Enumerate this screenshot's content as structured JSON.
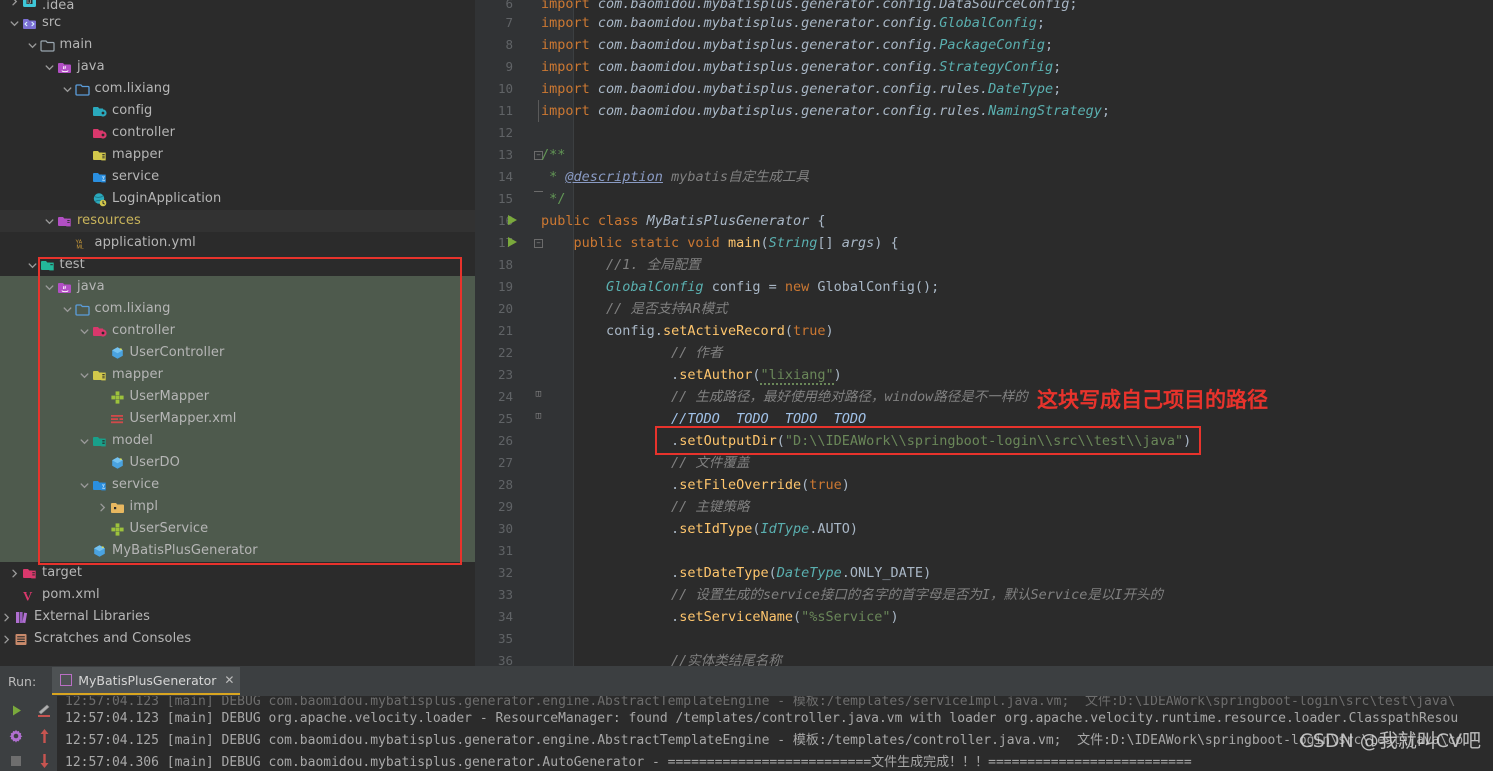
{
  "project_tree": {
    "rows": [
      {
        "indent": 0,
        "arrow": "right",
        "icon": "idea-folder-icon",
        "label": ".idea",
        "state": "normal",
        "clipped": true
      },
      {
        "indent": 0,
        "arrow": "down",
        "icon": "src-folder-icon",
        "label": "src",
        "state": "normal"
      },
      {
        "indent": 1,
        "arrow": "down",
        "icon": "plain-folder-icon",
        "label": "main",
        "state": "normal"
      },
      {
        "indent": 2,
        "arrow": "down",
        "icon": "java-source-folder-icon",
        "label": "java",
        "state": "normal"
      },
      {
        "indent": 3,
        "arrow": "down",
        "icon": "package-folder-icon",
        "label": "com.lixiang",
        "state": "normal"
      },
      {
        "indent": 4,
        "arrow": "none",
        "icon": "config-package-icon",
        "label": "config",
        "state": "normal"
      },
      {
        "indent": 4,
        "arrow": "none",
        "icon": "controller-package-icon",
        "label": "controller",
        "state": "normal"
      },
      {
        "indent": 4,
        "arrow": "none",
        "icon": "mapper-package-icon",
        "label": "mapper",
        "state": "normal"
      },
      {
        "indent": 4,
        "arrow": "none",
        "icon": "service-package-icon",
        "label": "service",
        "state": "normal"
      },
      {
        "indent": 4,
        "arrow": "none",
        "icon": "spring-boot-app-icon",
        "label": "LoginApplication",
        "state": "normal"
      },
      {
        "indent": 2,
        "arrow": "down",
        "icon": "resources-folder-icon",
        "label": "resources",
        "state": "dim",
        "color": "yellow"
      },
      {
        "indent": 3,
        "arrow": "none",
        "icon": "yaml-file-icon",
        "label": "application.yml",
        "state": "normal"
      },
      {
        "indent": 1,
        "arrow": "down",
        "icon": "test-folder-icon",
        "label": "test",
        "state": "normal"
      },
      {
        "indent": 2,
        "arrow": "down",
        "icon": "java-source-folder-icon",
        "label": "java",
        "state": "selected"
      },
      {
        "indent": 3,
        "arrow": "down",
        "icon": "package-folder-icon",
        "label": "com.lixiang",
        "state": "selected"
      },
      {
        "indent": 4,
        "arrow": "down",
        "icon": "controller-package-icon",
        "label": "controller",
        "state": "selected"
      },
      {
        "indent": 5,
        "arrow": "none",
        "icon": "java-class-icon",
        "label": "UserController",
        "state": "selected"
      },
      {
        "indent": 4,
        "arrow": "down",
        "icon": "mapper-package-icon",
        "label": "mapper",
        "state": "selected"
      },
      {
        "indent": 5,
        "arrow": "none",
        "icon": "java-interface-icon",
        "label": "UserMapper",
        "state": "selected"
      },
      {
        "indent": 5,
        "arrow": "none",
        "icon": "mybatis-xml-icon",
        "label": "UserMapper.xml",
        "state": "selected"
      },
      {
        "indent": 4,
        "arrow": "down",
        "icon": "model-package-icon",
        "label": "model",
        "state": "selected"
      },
      {
        "indent": 5,
        "arrow": "none",
        "icon": "java-class-icon",
        "label": "UserDO",
        "state": "selected"
      },
      {
        "indent": 4,
        "arrow": "down",
        "icon": "service-package-icon",
        "label": "service",
        "state": "selected"
      },
      {
        "indent": 5,
        "arrow": "right",
        "icon": "impl-folder-icon",
        "label": "impl",
        "state": "selected"
      },
      {
        "indent": 5,
        "arrow": "none",
        "icon": "java-interface-icon",
        "label": "UserService",
        "state": "selected"
      },
      {
        "indent": 4,
        "arrow": "none",
        "icon": "java-class-icon",
        "label": "MyBatisPlusGenerator",
        "state": "selected"
      },
      {
        "indent": 0,
        "arrow": "right",
        "icon": "target-folder-icon",
        "label": "target",
        "state": "normal"
      },
      {
        "indent": 0,
        "arrow": "none",
        "icon": "maven-pom-icon",
        "label": "pom.xml",
        "state": "normal"
      },
      {
        "indent": -1,
        "arrow": "right",
        "icon": "external-libraries-icon",
        "label": "External Libraries",
        "state": "normal"
      },
      {
        "indent": -1,
        "arrow": "right",
        "icon": "scratches-icon",
        "label": "Scratches and Consoles",
        "state": "normal"
      }
    ],
    "highlight_box_color": "#e8332c"
  },
  "editor": {
    "annotation": "这块写成自己项目的路径",
    "annotation_color": "#e8332c",
    "highlight_box_color": "#e8332c",
    "lines": [
      {
        "n": "6",
        "clipped": true,
        "html": "<span class=\"imp\">import</span> <span class=\"clsi\">com.baomidou.mybatisplus.generator.config.DataSourceConfig</span><span class=\"pln\">;</span>"
      },
      {
        "n": "7",
        "html": "<span class=\"imp\">import</span> <span class=\"clsi\">com.baomidou.mybatisplus.generator.config.</span><span class=\"type\">GlobalConfig</span><span class=\"pln\">;</span>"
      },
      {
        "n": "8",
        "html": "<span class=\"imp\">import</span> <span class=\"clsi\">com.baomidou.mybatisplus.generator.config.</span><span class=\"type\">PackageConfig</span><span class=\"pln\">;</span>"
      },
      {
        "n": "9",
        "html": "<span class=\"imp\">import</span> <span class=\"clsi\">com.baomidou.mybatisplus.generator.config.</span><span class=\"type\">StrategyConfig</span><span class=\"pln\">;</span>"
      },
      {
        "n": "10",
        "html": "<span class=\"imp\">import</span> <span class=\"clsi\">com.baomidou.mybatisplus.generator.config.rules.</span><span class=\"type\">DateType</span><span class=\"pln\">;</span>"
      },
      {
        "n": "11",
        "foldline": true,
        "html": "<span class=\"imp\">import</span> <span class=\"clsi\">com.baomidou.mybatisplus.generator.config.rules.</span><span class=\"type\">NamingStrategy</span><span class=\"pln\">;</span>"
      },
      {
        "n": "12",
        "html": ""
      },
      {
        "n": "13",
        "fold": "-",
        "html": "<span class=\"doc\">/**</span>"
      },
      {
        "n": "14",
        "html": " <span class=\"doc\">* </span><span class=\"tagl\">@description</span><span class=\"cmt\"> mybatis自定生成工具</span>"
      },
      {
        "n": "15",
        "fold": "u",
        "html": " <span class=\"doc\">*/</span>"
      },
      {
        "n": "16",
        "run": true,
        "html": "<span class=\"kw\">public class </span><span class=\"clsi\">MyBatisPlusGenerator</span> <span class=\"pln\">{</span>"
      },
      {
        "n": "17",
        "run": true,
        "fold": "-",
        "html": "    <span class=\"kw\">public static void </span><span class=\"mth\">main</span><span class=\"pln\">(</span><span class=\"type\">String</span><span class=\"pln\">[] </span><span class=\"clsi\">args</span><span class=\"pln\">) {</span>"
      },
      {
        "n": "18",
        "html": "        <span class=\"cmt\">//1. 全局配置</span>"
      },
      {
        "n": "19",
        "html": "        <span class=\"type\">GlobalConfig</span> <span class=\"pln\">config = </span><span class=\"kw\">new </span><span class=\"pln\">GlobalConfig();</span>"
      },
      {
        "n": "20",
        "html": "        <span class=\"cmt\">// 是否支持AR模式</span>"
      },
      {
        "n": "21",
        "html": "        <span class=\"pln\">config.</span><span class=\"mth\">setActiveRecord</span><span class=\"pln\">(</span><span class=\"kw\">true</span><span class=\"pln\">)</span>"
      },
      {
        "n": "22",
        "html": "                <span class=\"cmt\">// 作者</span>"
      },
      {
        "n": "23",
        "html": "                <span class=\"pln\">.</span><span class=\"mth\">setAuthor</span><span class=\"pln\">(</span><span class=\"str\"><span class=\"squig\">\"lixiang\"</span></span><span class=\"pln\">)</span>"
      },
      {
        "n": "24",
        "fold": "h",
        "html": "                <span class=\"cmt\">// 生成路径，最好使用绝对路径，window路径是不一样的</span>"
      },
      {
        "n": "25",
        "fold": "h2",
        "html": "                <span class=\"todo\">//TODO  TODO  TODO  TODO</span>"
      },
      {
        "n": "26",
        "html": "                <span class=\"pln\">.</span><span class=\"mth\">setOutputDir</span><span class=\"pln\">(</span><span class=\"str\">\"D:\\\\IDEAWork\\\\springboot-login\\\\src\\\\test\\\\java\"</span><span class=\"pln\">)</span>"
      },
      {
        "n": "27",
        "html": "                <span class=\"cmt\">// 文件覆盖</span>"
      },
      {
        "n": "28",
        "html": "                <span class=\"pln\">.</span><span class=\"mth\">setFileOverride</span><span class=\"pln\">(</span><span class=\"kw\">true</span><span class=\"pln\">)</span>"
      },
      {
        "n": "29",
        "html": "                <span class=\"cmt\">// 主键策略</span>"
      },
      {
        "n": "30",
        "html": "                <span class=\"pln\">.</span><span class=\"mth\">setIdType</span><span class=\"pln\">(</span><span class=\"type\">IdType</span><span class=\"pln\">.</span><span class=\"typen\">AUTO</span><span class=\"pln\">)</span>"
      },
      {
        "n": "31",
        "html": ""
      },
      {
        "n": "32",
        "html": "                <span class=\"pln\">.</span><span class=\"mth\">setDateType</span><span class=\"pln\">(</span><span class=\"type\">DateType</span><span class=\"pln\">.</span><span class=\"typen\">ONLY_DATE</span><span class=\"pln\">)</span>"
      },
      {
        "n": "33",
        "html": "                <span class=\"cmt\">// 设置生成的service接口的名字的首字母是否为I，默认Service是以I开头的</span>"
      },
      {
        "n": "34",
        "html": "                <span class=\"pln\">.</span><span class=\"mth\">setServiceName</span><span class=\"pln\">(</span><span class=\"str\">\"%sService\"</span><span class=\"pln\">)</span>"
      },
      {
        "n": "35",
        "html": ""
      },
      {
        "n": "36",
        "html": "                <span class=\"cmt\">//实体类结尾名称</span>"
      }
    ]
  },
  "run_panel": {
    "run_label": "Run:",
    "tab_name": "MyBatisPlusGenerator",
    "tab_close": "✕",
    "toolbar_icons": [
      "rerun-play-icon",
      "rerun-pencil-icon",
      "settings-gear-icon",
      "scroll-up-icon",
      "stop-square-icon",
      "scroll-down-icon"
    ],
    "console_lines": [
      {
        "clipped": true,
        "text": "12:57:04.123 [main] DEBUG com.baomidou.mybatisplus.generator.engine.AbstractTemplateEngine - 模板:/templates/serviceImpl.java.vm;  文件:D:\\IDEAWork\\springboot-login\\src\\test\\java\\"
      },
      {
        "clipped": false,
        "text": "12:57:04.123 [main] DEBUG org.apache.velocity.loader - ResourceManager: found /templates/controller.java.vm with loader org.apache.velocity.runtime.resource.loader.ClasspathResou"
      },
      {
        "clipped": false,
        "text": "12:57:04.125 [main] DEBUG com.baomidou.mybatisplus.generator.engine.AbstractTemplateEngine - 模板:/templates/controller.java.vm;  文件:D:\\IDEAWork\\springboot-login\\src\\test\\java\\co"
      },
      {
        "clipped": false,
        "text": "12:57:04.306 [main] DEBUG com.baomidou.mybatisplus.generator.AutoGenerator - ==========================文件生成完成！！！=========================="
      }
    ],
    "watermark": "CSDN @我就叫CV吧"
  }
}
